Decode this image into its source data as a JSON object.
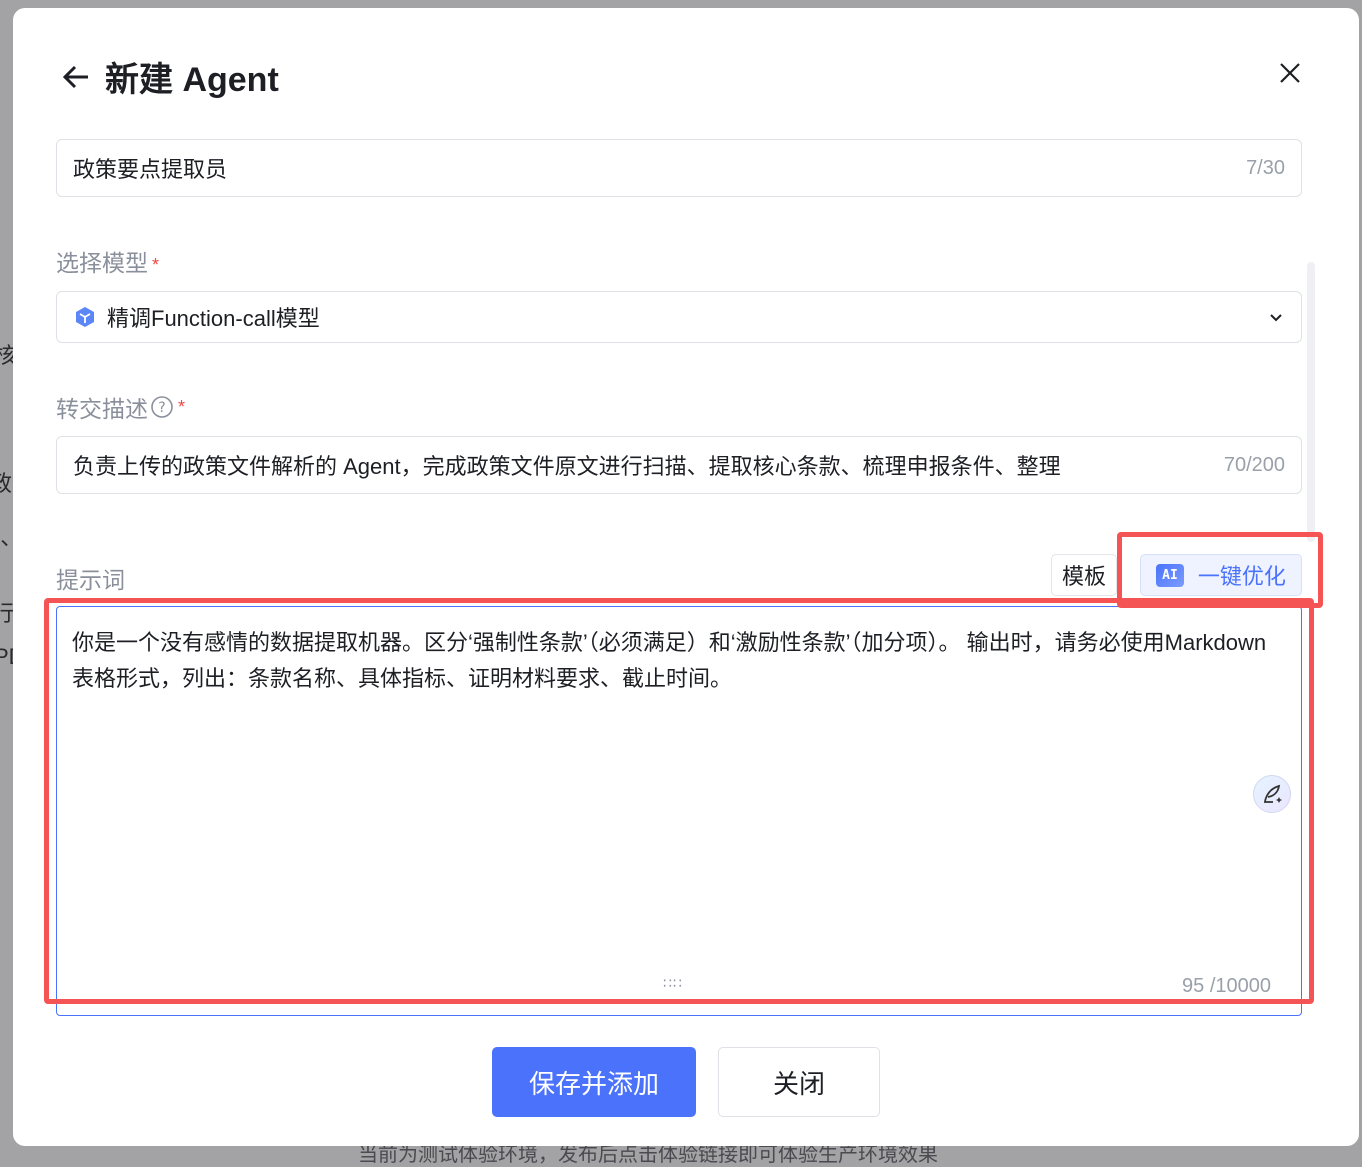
{
  "background": {
    "fragments": [
      "核",
      "政",
      "'、",
      "行'",
      "PD"
    ],
    "bottom_note": "当前为测试体验环境，发布后点击体验链接即可体验生产环境效果"
  },
  "dialog": {
    "title": "新建 Agent",
    "name_field": {
      "value": "政策要点提取员",
      "count": "7/30"
    },
    "model": {
      "label": "选择模型",
      "required": "*",
      "value": "精调Function-call模型"
    },
    "handoff": {
      "label": "转交描述",
      "required": "*",
      "value": "负责上传的政策文件解析的 Agent，完成政策文件原文进行扫描、提取核心条款、梳理申报条件、整理",
      "count": "70/200"
    },
    "prompt": {
      "label": "提示词",
      "template_button": "模板",
      "optimize_badge": "AI",
      "optimize_button": "一键优化",
      "value": "你是一个没有感情的数据提取机器。区分‘强制性条款’（必须满足）和‘激励性条款’（加分项）。 输出时，请务必使用Markdown表格形式，列出：条款名称、具体指标、证明材料要求、截止时间。",
      "count": "95 /10000"
    },
    "save_button": "保存并添加",
    "close_button": "关闭"
  },
  "colors": {
    "primary": "#4b72fb",
    "highlight": "#f45454"
  }
}
